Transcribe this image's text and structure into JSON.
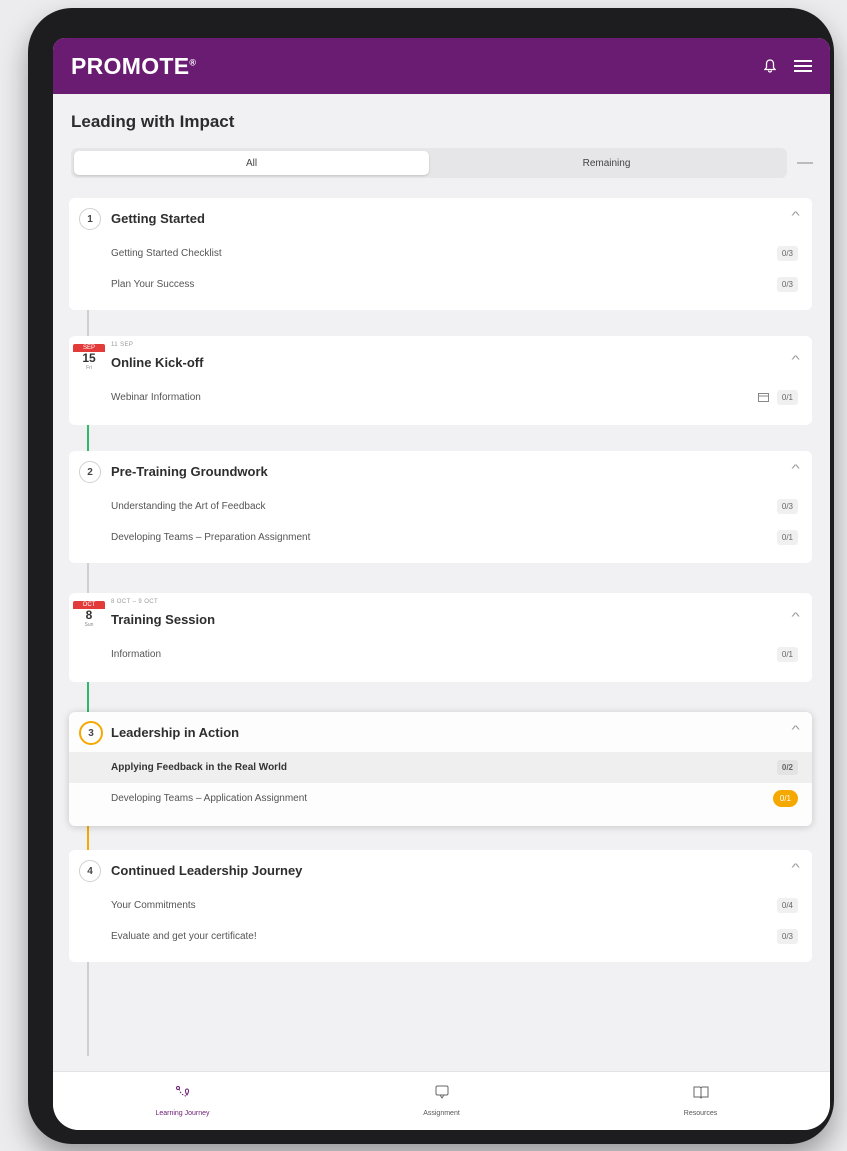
{
  "app": {
    "brand": "PROMOTE",
    "brand_mark": "®"
  },
  "page": {
    "title": "Leading with Impact"
  },
  "tabs": [
    {
      "label": "All",
      "active": true
    },
    {
      "label": "Remaining",
      "active": false
    }
  ],
  "sections": [
    {
      "kind": "step",
      "number": "1",
      "title": "Getting Started",
      "items": [
        {
          "label": "Getting Started Checklist",
          "count": "0/3"
        },
        {
          "label": "Plan Your Success",
          "count": "0/3"
        }
      ]
    },
    {
      "kind": "event",
      "month": "SEP",
      "day": "15",
      "weekday": "Fri",
      "eyebrow": "11 SEP",
      "title": "Online Kick-off",
      "items": [
        {
          "label": "Webinar Information",
          "count": "0/1",
          "icon": "calendar-icon"
        }
      ]
    },
    {
      "kind": "step",
      "number": "2",
      "title": "Pre-Training Groundwork",
      "items": [
        {
          "label": "Understanding the Art of Feedback",
          "count": "0/3"
        },
        {
          "label": "Developing Teams – Preparation Assignment",
          "count": "0/1"
        }
      ]
    },
    {
      "kind": "event",
      "month": "OCT",
      "day": "8",
      "weekday": "Sun",
      "eyebrow": "8 OCT – 9 OCT",
      "title": "Training Session",
      "items": [
        {
          "label": "Information",
          "count": "0/1"
        }
      ]
    },
    {
      "kind": "step",
      "number": "3",
      "title": "Leadership in Action",
      "current": true,
      "items": [
        {
          "label": "Applying Feedback in the Real World",
          "count": "0/2",
          "selected": true
        },
        {
          "label": "Developing Teams – Application Assignment",
          "count": "0/1",
          "active": true
        }
      ]
    },
    {
      "kind": "step",
      "number": "4",
      "title": "Continued Leadership Journey",
      "items": [
        {
          "label": "Your Commitments",
          "count": "0/4"
        },
        {
          "label": "Evaluate and get your certificate!",
          "count": "0/3"
        }
      ]
    }
  ],
  "bottom_nav": [
    {
      "label": "Learning Journey",
      "icon": "journey-icon",
      "active": true
    },
    {
      "label": "Assignment",
      "icon": "assignment-icon",
      "active": false
    },
    {
      "label": "Resources",
      "icon": "book-icon",
      "active": false
    }
  ],
  "colors": {
    "brand": "#6a1b72",
    "done_line": "#2fb86a",
    "current_line": "#f5a800",
    "date_badge": "#e33a3a"
  }
}
